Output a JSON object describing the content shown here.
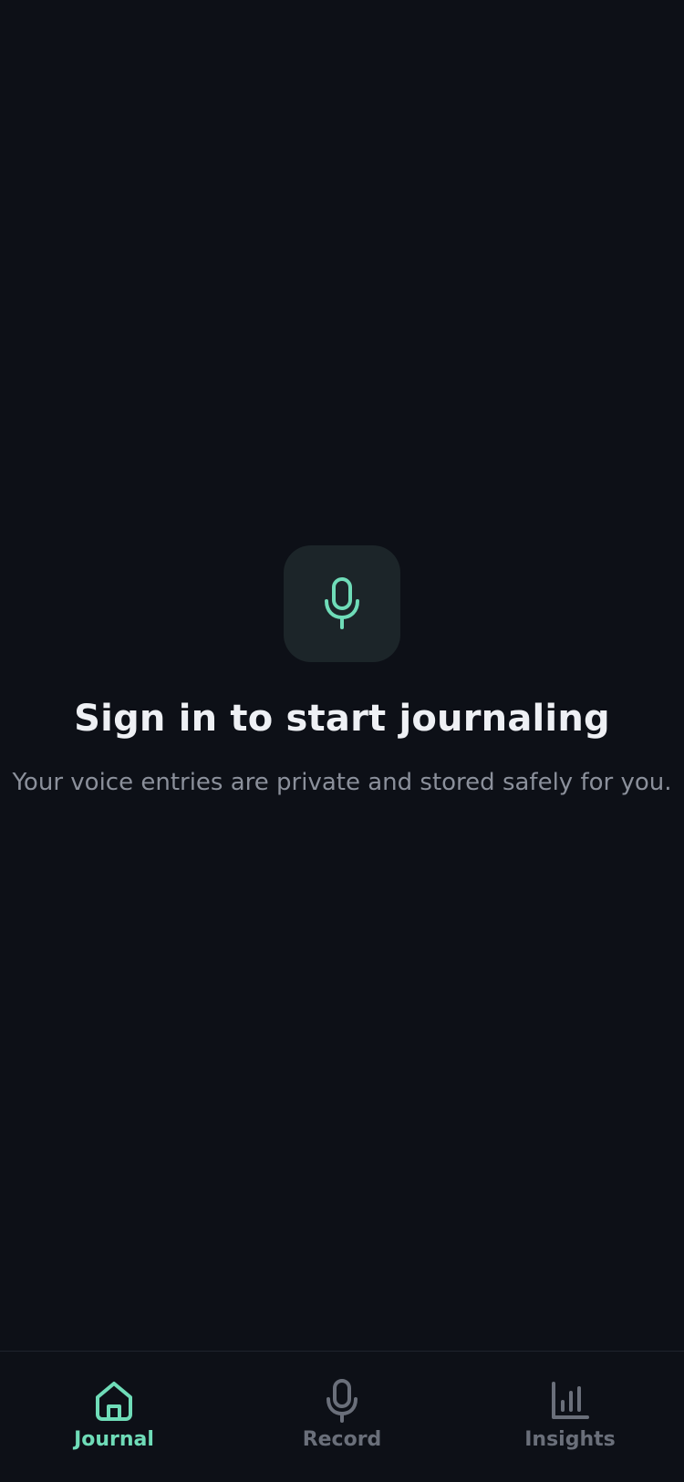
{
  "colors": {
    "background": "#0d1017",
    "accent": "#6fdcb8",
    "icon_tile": "#1c2529",
    "title": "#eef0f4",
    "subtitle": "#8b909b",
    "inactive": "#6a6f7a"
  },
  "empty_state": {
    "icon": "microphone-icon",
    "title": "Sign in to start journaling",
    "subtitle": "Your voice entries are private and stored safely for you."
  },
  "tabs": [
    {
      "label": "Journal",
      "icon": "home-icon",
      "active": true
    },
    {
      "label": "Record",
      "icon": "microphone-icon",
      "active": false
    },
    {
      "label": "Insights",
      "icon": "bar-chart-icon",
      "active": false
    }
  ]
}
